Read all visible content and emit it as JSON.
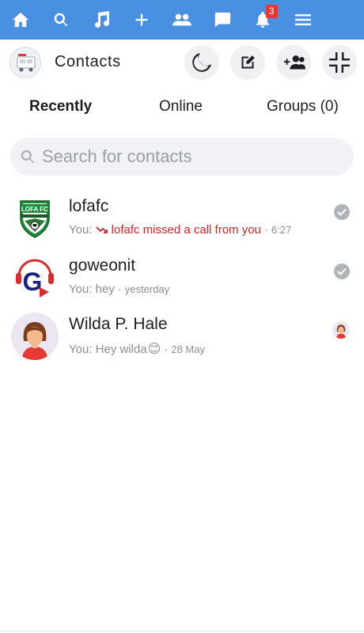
{
  "topbar": {
    "bg_color": "#4a90e2",
    "items": [
      {
        "name": "home-icon"
      },
      {
        "name": "search-icon"
      },
      {
        "name": "music-icon"
      },
      {
        "name": "plus-icon"
      },
      {
        "name": "friends-icon"
      },
      {
        "name": "chat-icon"
      },
      {
        "name": "bell-icon",
        "badge": "3"
      },
      {
        "name": "menu-icon"
      }
    ]
  },
  "header": {
    "title": "Contacts",
    "buttons": [
      "moon-icon",
      "compose-icon",
      "add-friend-icon",
      "collapse-icon"
    ]
  },
  "tabs": [
    {
      "label": "Recently",
      "active": true
    },
    {
      "label": "Online",
      "active": false
    },
    {
      "label": "Groups (0)",
      "active": false
    }
  ],
  "search": {
    "placeholder": "Search for contacts",
    "value": ""
  },
  "contacts": [
    {
      "name": "lofafc",
      "prefix": "You:",
      "message": "lofafc missed a call from you",
      "missed_call": true,
      "time": "6:27",
      "status": "seen-check-icon"
    },
    {
      "name": "goweonit",
      "prefix": "You: hey",
      "message": "",
      "missed_call": false,
      "time": "yesterday",
      "status": "seen-check-icon"
    },
    {
      "name": "Wilda P. Hale",
      "prefix": "You: Hey wilda",
      "emoji": "😊",
      "message": "",
      "missed_call": false,
      "time": "28 May",
      "status": "seen-avatar"
    }
  ],
  "colors": {
    "missed": "#c62828",
    "muted_text": "#8a8d91"
  }
}
